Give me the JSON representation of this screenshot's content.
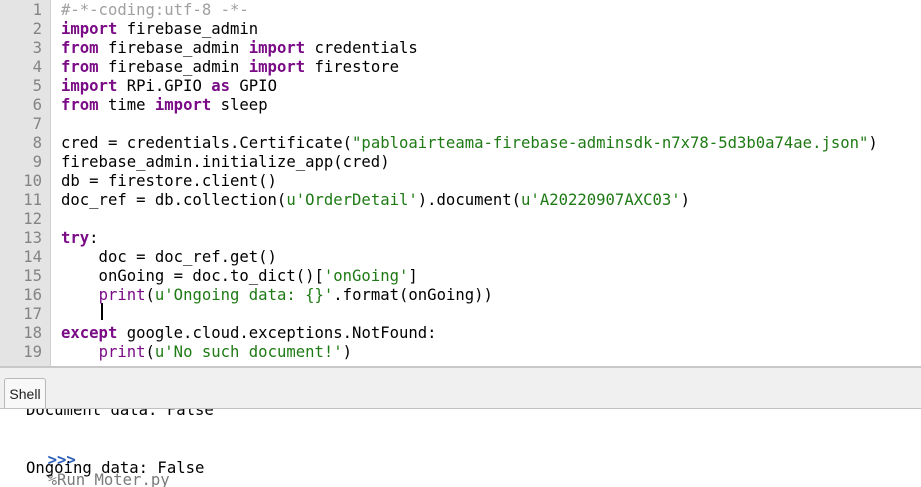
{
  "editor": {
    "line_numbers": [
      "1",
      "2",
      "3",
      "4",
      "5",
      "6",
      "7",
      "8",
      "9",
      "10",
      "11",
      "12",
      "13",
      "14",
      "15",
      "16",
      "17",
      "18",
      "19"
    ],
    "lines": [
      [
        {
          "t": "#-*-coding:utf-8 -*-",
          "c": "cm"
        }
      ],
      [
        {
          "t": "import",
          "c": "kw"
        },
        {
          "t": " firebase_admin",
          "c": ""
        }
      ],
      [
        {
          "t": "from",
          "c": "kw"
        },
        {
          "t": " firebase_admin ",
          "c": ""
        },
        {
          "t": "import",
          "c": "kw"
        },
        {
          "t": " credentials",
          "c": ""
        }
      ],
      [
        {
          "t": "from",
          "c": "kw"
        },
        {
          "t": " firebase_admin ",
          "c": ""
        },
        {
          "t": "import",
          "c": "kw"
        },
        {
          "t": " firestore",
          "c": ""
        }
      ],
      [
        {
          "t": "import",
          "c": "kw"
        },
        {
          "t": " RPi.GPIO ",
          "c": ""
        },
        {
          "t": "as",
          "c": "kw"
        },
        {
          "t": " GPIO",
          "c": ""
        }
      ],
      [
        {
          "t": "from",
          "c": "kw"
        },
        {
          "t": " time ",
          "c": ""
        },
        {
          "t": "import",
          "c": "kw"
        },
        {
          "t": " sleep",
          "c": ""
        }
      ],
      [],
      [
        {
          "t": "cred = credentials.Certificate(",
          "c": ""
        },
        {
          "t": "\"pabloairteama-firebase-adminsdk-n7x78-5d3b0a74ae.json\"",
          "c": "str"
        },
        {
          "t": ")",
          "c": ""
        }
      ],
      [
        {
          "t": "firebase_admin.initialize_app(cred)",
          "c": ""
        }
      ],
      [
        {
          "t": "db = firestore.client()",
          "c": ""
        }
      ],
      [
        {
          "t": "doc_ref = db.collection(",
          "c": ""
        },
        {
          "t": "u'OrderDetail'",
          "c": "str"
        },
        {
          "t": ").document(",
          "c": ""
        },
        {
          "t": "u'A20220907AXC03'",
          "c": "str"
        },
        {
          "t": ")",
          "c": ""
        }
      ],
      [],
      [
        {
          "t": "try",
          "c": "kw"
        },
        {
          "t": ":",
          "c": ""
        }
      ],
      [
        {
          "t": "    doc = doc_ref.get()",
          "c": ""
        }
      ],
      [
        {
          "t": "    onGoing = doc.to_dict()[",
          "c": ""
        },
        {
          "t": "'onGoing'",
          "c": "str"
        },
        {
          "t": "]",
          "c": ""
        }
      ],
      [
        {
          "t": "    ",
          "c": ""
        },
        {
          "t": "print",
          "c": "fn"
        },
        {
          "t": "(",
          "c": ""
        },
        {
          "t": "u'Ongoing data: {}'",
          "c": "str"
        },
        {
          "t": ".format(onGoing))",
          "c": ""
        }
      ],
      [],
      [
        {
          "t": "except",
          "c": "kw"
        },
        {
          "t": " google.cloud.exceptions.NotFound:",
          "c": ""
        }
      ],
      [
        {
          "t": "    ",
          "c": ""
        },
        {
          "t": "print",
          "c": "fn"
        },
        {
          "t": "(",
          "c": ""
        },
        {
          "t": "u'No such document!'",
          "c": "str"
        },
        {
          "t": ")",
          "c": ""
        }
      ]
    ]
  },
  "shell": {
    "tab_label": "Shell",
    "prev_output": "Document data: False",
    "prompt": ">>>",
    "command": "%Run Moter.py",
    "output": "Ongoing data: False"
  }
}
